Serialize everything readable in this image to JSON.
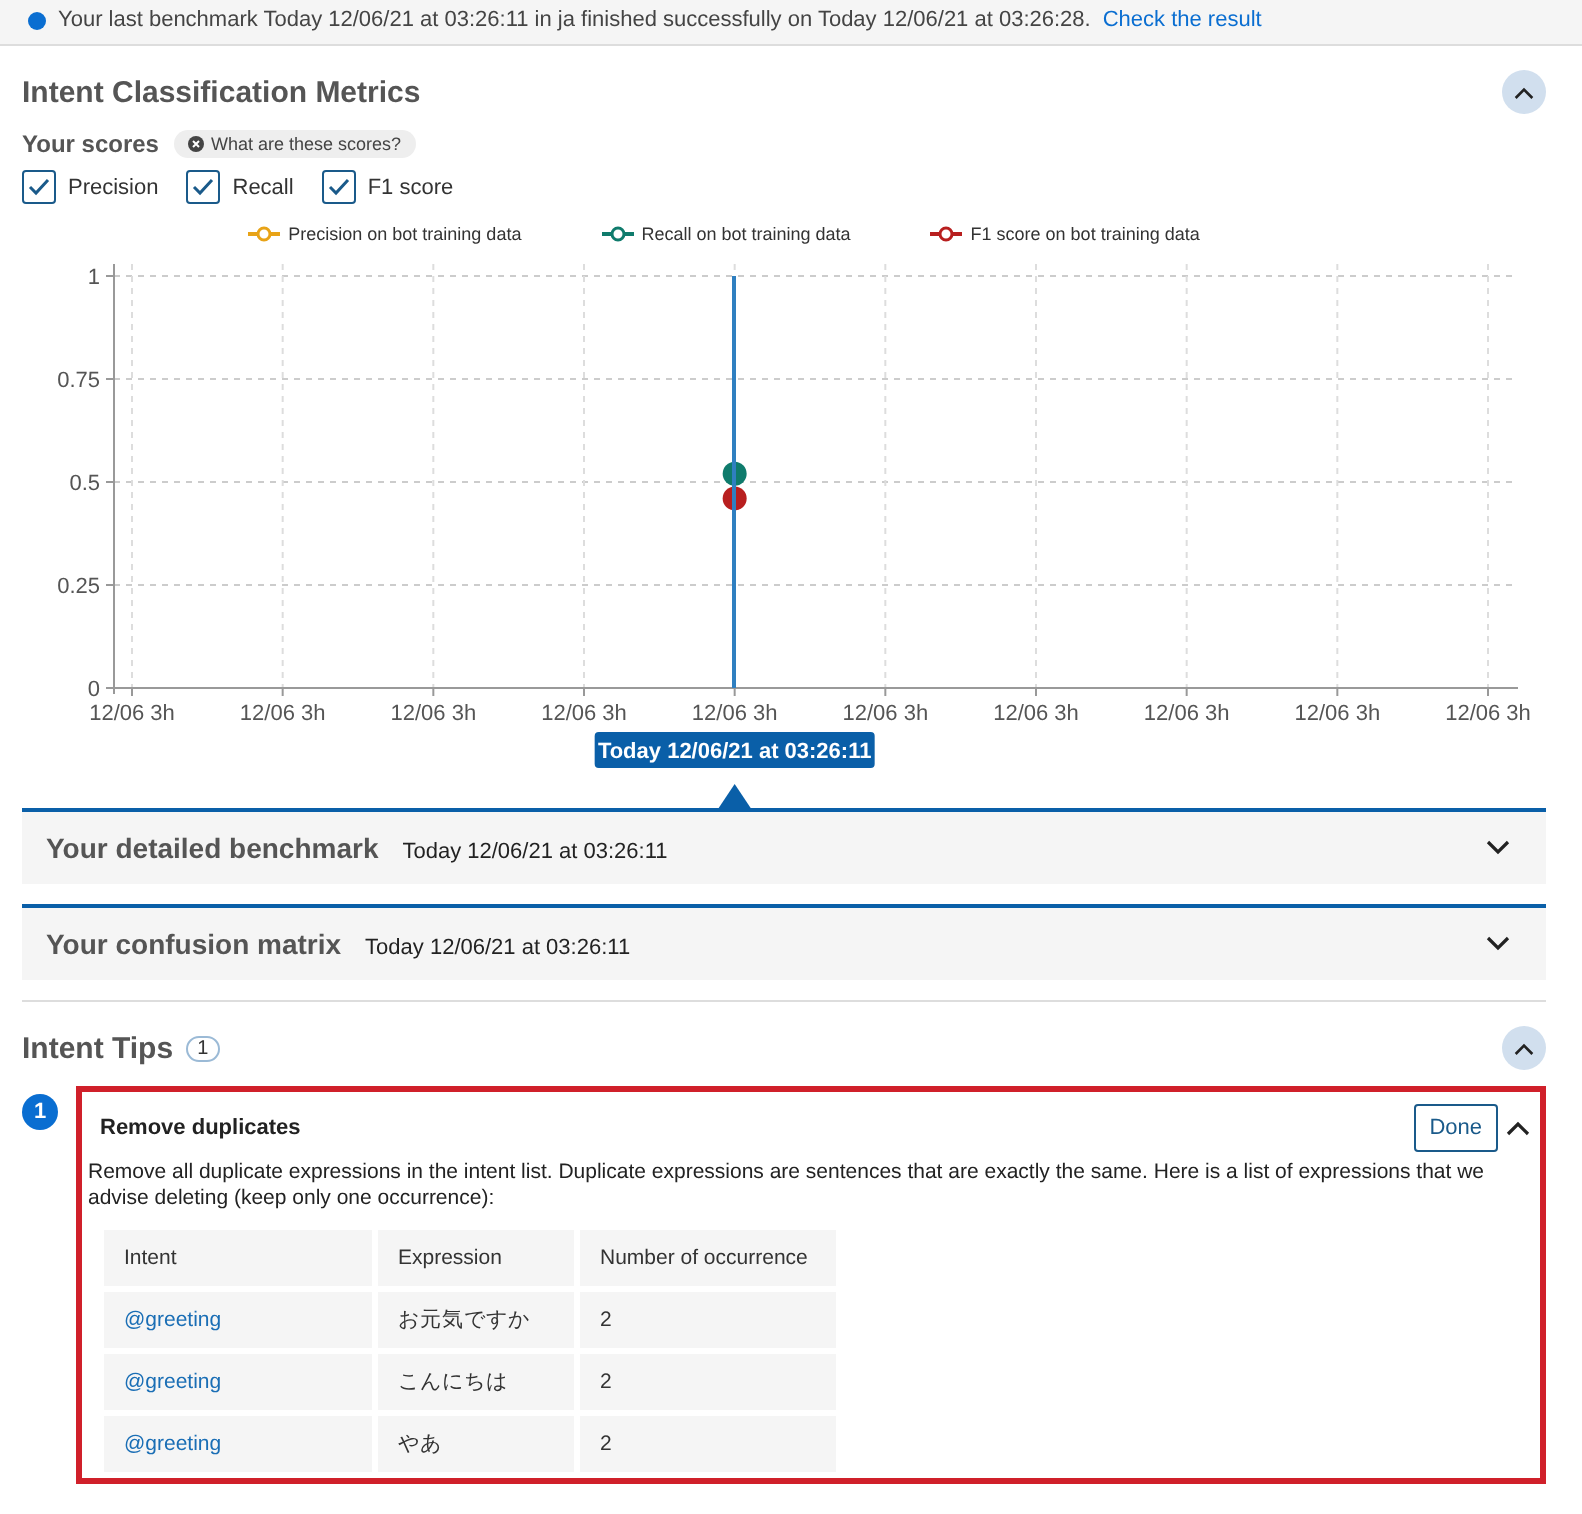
{
  "banner": {
    "text": "Your last benchmark Today 12/06/21 at 03:26:11 in ja finished successfully on Today 12/06/21 at 03:26:28.",
    "link": "Check the result"
  },
  "metrics": {
    "title": "Intent Classification Metrics",
    "expanded": true,
    "scores_label": "Your scores",
    "help_chip": "What are these scores?",
    "checkboxes": [
      {
        "label": "Precision",
        "checked": true
      },
      {
        "label": "Recall",
        "checked": true
      },
      {
        "label": "F1 score",
        "checked": true
      }
    ],
    "chart_data": {
      "type": "line",
      "categories": [
        "12/06 3h",
        "12/06 3h",
        "12/06 3h",
        "12/06 3h",
        "12/06 3h",
        "12/06 3h",
        "12/06 3h",
        "12/06 3h",
        "12/06 3h",
        "12/06 3h"
      ],
      "ylim": [
        0,
        1
      ],
      "yticks": [
        0,
        0.25,
        0.5,
        0.75,
        1
      ],
      "series": [
        {
          "name": "Precision on bot training data",
          "color": "#e8a317",
          "values": [
            null,
            null,
            null,
            null,
            null,
            null,
            null,
            null,
            null,
            null
          ]
        },
        {
          "name": "Recall on bot training data",
          "color": "#0f7b6c",
          "marker": "circle",
          "values": [
            null,
            null,
            null,
            null,
            0.52,
            null,
            null,
            null,
            null,
            null
          ]
        },
        {
          "name": "F1 score on bot training data",
          "color": "#b81f1f",
          "marker": "circle",
          "values": [
            null,
            null,
            null,
            null,
            0.46,
            null,
            null,
            null,
            null,
            null
          ]
        }
      ],
      "grid": true,
      "annotations": [
        "Today 12/06/21 at 03:26:11"
      ]
    }
  },
  "accordions": [
    {
      "title": "Your detailed benchmark",
      "date": "Today 12/06/21 at 03:26:11",
      "expanded": false
    },
    {
      "title": "Your confusion matrix",
      "date": "Today 12/06/21 at 03:26:11",
      "expanded": false
    }
  ],
  "tips": {
    "title": "Intent Tips",
    "count": "1",
    "expanded": true,
    "items": [
      {
        "number": "1",
        "title": "Remove duplicates",
        "button": "Done",
        "expanded": true,
        "highlighted": true,
        "description": "Remove all duplicate expressions in the intent list. Duplicate expressions are sentences that are exactly the same. Here is a list of expressions that we advise deleting (keep only one occurrence):",
        "table": {
          "columns": [
            "Intent",
            "Expression",
            "Number of occurrence"
          ],
          "rows": [
            [
              "@greeting",
              "お元気ですか",
              "2"
            ],
            [
              "@greeting",
              "こんにちは",
              "2"
            ],
            [
              "@greeting",
              "やあ",
              "2"
            ]
          ]
        }
      }
    ]
  }
}
